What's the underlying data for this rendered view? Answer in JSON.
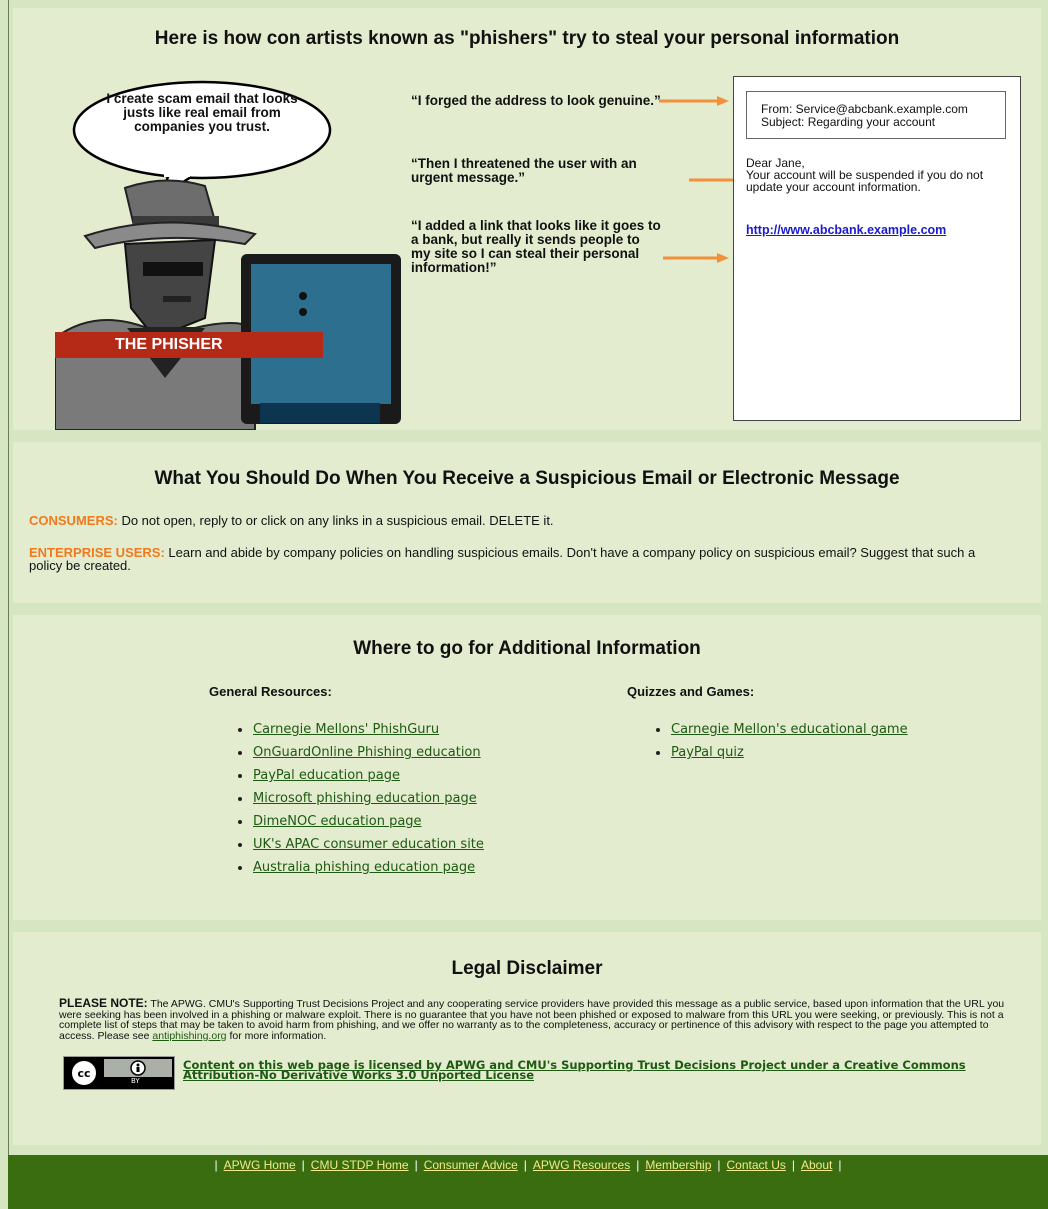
{
  "section1": {
    "title": "Here is how con artists known as \"phishers\" try to steal your personal information",
    "bubble_text": "I create scam email that looks justs like real email from companies you trust.",
    "phisher_label": "THE PHISHER",
    "quotes": [
      "“I forged the address to look genuine.”",
      "“Then I threatened the user with an urgent message.”",
      "“I added a link that looks like it goes to a bank, but really it sends people to my site so I can steal their personal information!”"
    ],
    "email": {
      "from": "From: Service@abcbank.example.com",
      "subject": "Subject: Regarding your account",
      "greeting": "Dear Jane,",
      "body": "Your account will be suspended if you do not update your account information.",
      "link": "http://www.abcbank.example.com"
    }
  },
  "section2": {
    "title": "What You Should Do When You Receive a Suspicious Email or Electronic Message",
    "consumers_label": "CONSUMERS:",
    "consumers_text": " Do not open, reply to or click on any links in a suspicious email. DELETE it.",
    "enterprise_label": "ENTERPRISE USERS:",
    "enterprise_text": " Learn and abide by company policies on handling suspicious emails. Don't have a company policy on suspicious email? Suggest that such a policy be created."
  },
  "section3": {
    "title": "Where to go for Additional Information",
    "general_heading": "General Resources:",
    "general_links": [
      "Carnegie Mellons' PhishGuru",
      "OnGuardOnline Phishing education",
      "PayPal education page",
      "Microsoft phishing education page",
      "DimeNOC education page",
      "UK's APAC consumer education site",
      "Australia phishing education page"
    ],
    "quizzes_heading": "Quizzes and Games:",
    "quiz_links": [
      "Carnegie Mellon's educational game",
      "PayPal quiz"
    ]
  },
  "section4": {
    "title": "Legal Disclaimer",
    "note_label": "PLEASE NOTE:",
    "note_text": " The APWG. CMU's Supporting Trust Decisions Project and any cooperating service providers have provided this message as a public service, based upon information that the URL you were seeking has been involved in a phishing or malware exploit. There is no guarantee that you have not been phished or exposed to malware from this URL you were seeking, or previously. This is not a complete list of steps that may be taken to avoid harm from phishing, and we offer no warranty as to the completeness, accuracy or pertinence of this advisory with respect to the page you attempted to access. Please see ",
    "note_link": "antiphishing.org",
    "note_tail": " for more information.",
    "cc_badge_text": "BY",
    "license_text": "Content on this web page is licensed by APWG and CMU's Supporting Trust Decisions Project under a Creative Commons Attribution-No Derivative Works 3.0 Unported License"
  },
  "footer": {
    "links": [
      "APWG Home",
      "CMU STDP Home",
      "Consumer Advice",
      "APWG Resources",
      "Membership",
      "Contact Us",
      "About"
    ],
    "separator": "|"
  },
  "colors": {
    "background": "#d7e6c2",
    "panel": "#e3eccf",
    "orange": "#f07a1c",
    "link_green": "#1e5a12",
    "footer_green": "#3a6d10",
    "phisher_red": "#b52a16"
  }
}
